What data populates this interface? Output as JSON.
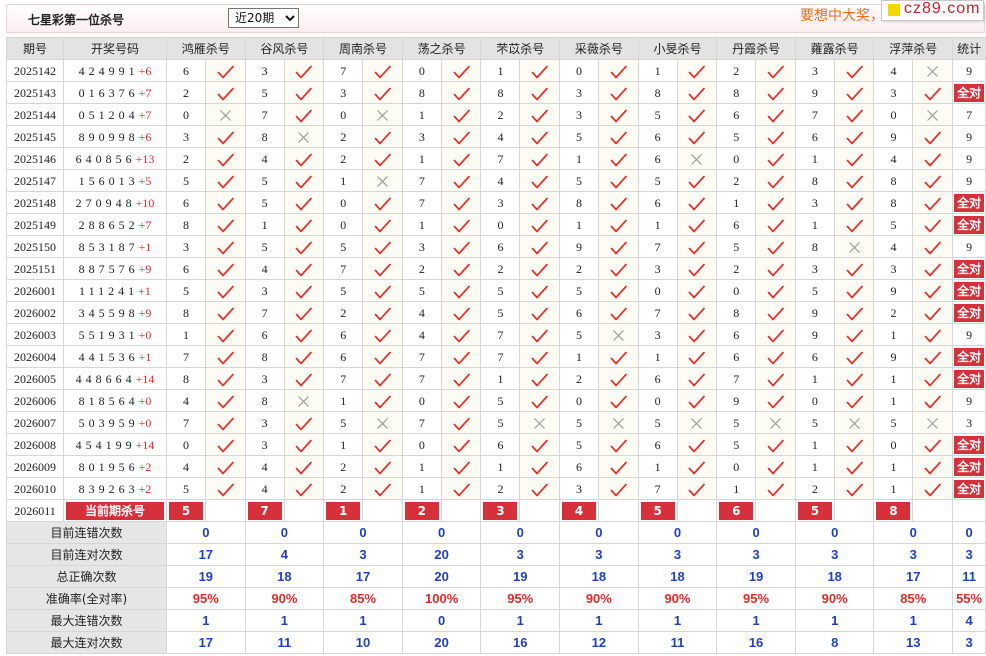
{
  "header": {
    "title": "七星彩第一位杀号",
    "period_select": {
      "selected": "近20期"
    },
    "promo": "要想中大奖，",
    "logo": "cz89.com"
  },
  "colors": {
    "check": "#e6302b",
    "cross": "#9c9c9c",
    "badge": "#d6303a",
    "stat_blue": "#1f3fc4",
    "stat_red": "#e12a2a",
    "promo": "#f06a1c",
    "logo_text": "#c8202a",
    "logo_square": "#f5d800",
    "draw_special": "#e12a2a"
  },
  "table": {
    "col_period": "期号",
    "col_draw": "开奖号码",
    "experts": [
      "鸿雁杀号",
      "谷风杀号",
      "周南杀号",
      "荡之杀号",
      "芣苡杀号",
      "采薇杀号",
      "小旻杀号",
      "丹霞杀号",
      "蕹露杀号",
      "浮萍杀号"
    ],
    "col_stat": "统计",
    "rows": [
      {
        "period": "2025142",
        "main": "424991",
        "special": "+6",
        "kills": [
          6,
          3,
          7,
          0,
          1,
          0,
          1,
          2,
          3,
          4
        ],
        "ok": [
          1,
          1,
          1,
          1,
          1,
          1,
          1,
          1,
          1,
          0
        ],
        "stat": "9"
      },
      {
        "period": "2025143",
        "main": "016376",
        "special": "+7",
        "kills": [
          2,
          5,
          3,
          8,
          8,
          3,
          8,
          8,
          9,
          3
        ],
        "ok": [
          1,
          1,
          1,
          1,
          1,
          1,
          1,
          1,
          1,
          1
        ],
        "stat": "全对"
      },
      {
        "period": "2025144",
        "main": "051204",
        "special": "+7",
        "kills": [
          0,
          7,
          0,
          1,
          2,
          3,
          5,
          6,
          7,
          0
        ],
        "ok": [
          0,
          1,
          0,
          1,
          1,
          1,
          1,
          1,
          1,
          0
        ],
        "stat": "7"
      },
      {
        "period": "2025145",
        "main": "890998",
        "special": "+6",
        "kills": [
          3,
          8,
          2,
          3,
          4,
          5,
          6,
          5,
          6,
          9
        ],
        "ok": [
          1,
          0,
          1,
          1,
          1,
          1,
          1,
          1,
          1,
          1
        ],
        "stat": "9"
      },
      {
        "period": "2025146",
        "main": "640856",
        "special": "+13",
        "kills": [
          2,
          4,
          2,
          1,
          7,
          1,
          6,
          0,
          1,
          4
        ],
        "ok": [
          1,
          1,
          1,
          1,
          1,
          1,
          0,
          1,
          1,
          1
        ],
        "stat": "9"
      },
      {
        "period": "2025147",
        "main": "156013",
        "special": "+5",
        "kills": [
          5,
          5,
          1,
          7,
          4,
          5,
          5,
          2,
          8,
          8
        ],
        "ok": [
          1,
          1,
          0,
          1,
          1,
          1,
          1,
          1,
          1,
          1
        ],
        "stat": "9"
      },
      {
        "period": "2025148",
        "main": "270948",
        "special": "+10",
        "kills": [
          6,
          5,
          0,
          7,
          3,
          8,
          6,
          1,
          3,
          8
        ],
        "ok": [
          1,
          1,
          1,
          1,
          1,
          1,
          1,
          1,
          1,
          1
        ],
        "stat": "全对"
      },
      {
        "period": "2025149",
        "main": "288652",
        "special": "+7",
        "kills": [
          8,
          1,
          0,
          1,
          0,
          1,
          1,
          6,
          1,
          5
        ],
        "ok": [
          1,
          1,
          1,
          1,
          1,
          1,
          1,
          1,
          1,
          1
        ],
        "stat": "全对"
      },
      {
        "period": "2025150",
        "main": "853187",
        "special": "+1",
        "kills": [
          3,
          5,
          5,
          3,
          6,
          9,
          7,
          5,
          8,
          4
        ],
        "ok": [
          1,
          1,
          1,
          1,
          1,
          1,
          1,
          1,
          0,
          1
        ],
        "stat": "9"
      },
      {
        "period": "2025151",
        "main": "887576",
        "special": "+9",
        "kills": [
          6,
          4,
          7,
          2,
          2,
          2,
          3,
          2,
          3,
          3
        ],
        "ok": [
          1,
          1,
          1,
          1,
          1,
          1,
          1,
          1,
          1,
          1
        ],
        "stat": "全对"
      },
      {
        "period": "2026001",
        "main": "111241",
        "special": "+1",
        "kills": [
          5,
          3,
          5,
          5,
          5,
          5,
          0,
          0,
          5,
          9
        ],
        "ok": [
          1,
          1,
          1,
          1,
          1,
          1,
          1,
          1,
          1,
          1
        ],
        "stat": "全对"
      },
      {
        "period": "2026002",
        "main": "345598",
        "special": "+9",
        "kills": [
          8,
          7,
          2,
          4,
          5,
          6,
          7,
          8,
          9,
          2
        ],
        "ok": [
          1,
          1,
          1,
          1,
          1,
          1,
          1,
          1,
          1,
          1
        ],
        "stat": "全对"
      },
      {
        "period": "2026003",
        "main": "551931",
        "special": "+0",
        "kills": [
          1,
          6,
          6,
          4,
          7,
          5,
          3,
          6,
          9,
          1
        ],
        "ok": [
          1,
          1,
          1,
          1,
          1,
          0,
          1,
          1,
          1,
          1
        ],
        "stat": "9"
      },
      {
        "period": "2026004",
        "main": "441536",
        "special": "+1",
        "kills": [
          7,
          8,
          6,
          7,
          7,
          1,
          1,
          6,
          6,
          9
        ],
        "ok": [
          1,
          1,
          1,
          1,
          1,
          1,
          1,
          1,
          1,
          1
        ],
        "stat": "全对"
      },
      {
        "period": "2026005",
        "main": "448664",
        "special": "+14",
        "kills": [
          8,
          3,
          7,
          7,
          1,
          2,
          6,
          7,
          1,
          1
        ],
        "ok": [
          1,
          1,
          1,
          1,
          1,
          1,
          1,
          1,
          1,
          1
        ],
        "stat": "全对"
      },
      {
        "period": "2026006",
        "main": "818564",
        "special": "+0",
        "kills": [
          4,
          8,
          1,
          0,
          5,
          0,
          0,
          9,
          0,
          1
        ],
        "ok": [
          1,
          0,
          1,
          1,
          1,
          1,
          1,
          1,
          1,
          1
        ],
        "stat": "9"
      },
      {
        "period": "2026007",
        "main": "503959",
        "special": "+0",
        "kills": [
          7,
          3,
          5,
          7,
          5,
          5,
          5,
          5,
          5,
          5
        ],
        "ok": [
          1,
          1,
          0,
          1,
          0,
          0,
          0,
          0,
          0,
          0
        ],
        "stat": "3"
      },
      {
        "period": "2026008",
        "main": "454199",
        "special": "+14",
        "kills": [
          0,
          3,
          1,
          0,
          6,
          5,
          6,
          5,
          1,
          0
        ],
        "ok": [
          1,
          1,
          1,
          1,
          1,
          1,
          1,
          1,
          1,
          1
        ],
        "stat": "全对"
      },
      {
        "period": "2026009",
        "main": "801956",
        "special": "+2",
        "kills": [
          4,
          4,
          2,
          1,
          1,
          6,
          1,
          0,
          1,
          1
        ],
        "ok": [
          1,
          1,
          1,
          1,
          1,
          1,
          1,
          1,
          1,
          1
        ],
        "stat": "全对"
      },
      {
        "period": "2026010",
        "main": "839263",
        "special": "+2",
        "kills": [
          5,
          4,
          2,
          1,
          2,
          3,
          7,
          1,
          2,
          1
        ],
        "ok": [
          1,
          1,
          1,
          1,
          1,
          1,
          1,
          1,
          1,
          1
        ],
        "stat": "全对"
      }
    ],
    "current": {
      "period": "2026011",
      "label": "当前期杀号",
      "kills": [
        5,
        7,
        1,
        2,
        3,
        4,
        5,
        6,
        5,
        8
      ]
    },
    "stats": [
      {
        "label": "目前连错次数",
        "color": "stat_blue",
        "values": [
          "0",
          "0",
          "0",
          "0",
          "0",
          "0",
          "0",
          "0",
          "0",
          "0",
          "0"
        ]
      },
      {
        "label": "目前连对次数",
        "color": "stat_blue",
        "values": [
          "17",
          "4",
          "3",
          "20",
          "3",
          "3",
          "3",
          "3",
          "3",
          "3",
          "3"
        ]
      },
      {
        "label": "总正确次数",
        "color": "stat_blue",
        "values": [
          "19",
          "18",
          "17",
          "20",
          "19",
          "18",
          "18",
          "19",
          "18",
          "17",
          "11"
        ]
      },
      {
        "label": "准确率(全对率)",
        "color": "stat_red",
        "values": [
          "95%",
          "90%",
          "85%",
          "100%",
          "95%",
          "90%",
          "90%",
          "95%",
          "90%",
          "85%",
          "55%"
        ]
      },
      {
        "label": "最大连错次数",
        "color": "stat_blue",
        "values": [
          "1",
          "1",
          "1",
          "0",
          "1",
          "1",
          "1",
          "1",
          "1",
          "1",
          "4"
        ]
      },
      {
        "label": "最大连对次数",
        "color": "stat_blue",
        "values": [
          "17",
          "11",
          "10",
          "20",
          "16",
          "12",
          "11",
          "16",
          "8",
          "13",
          "3"
        ]
      }
    ]
  }
}
